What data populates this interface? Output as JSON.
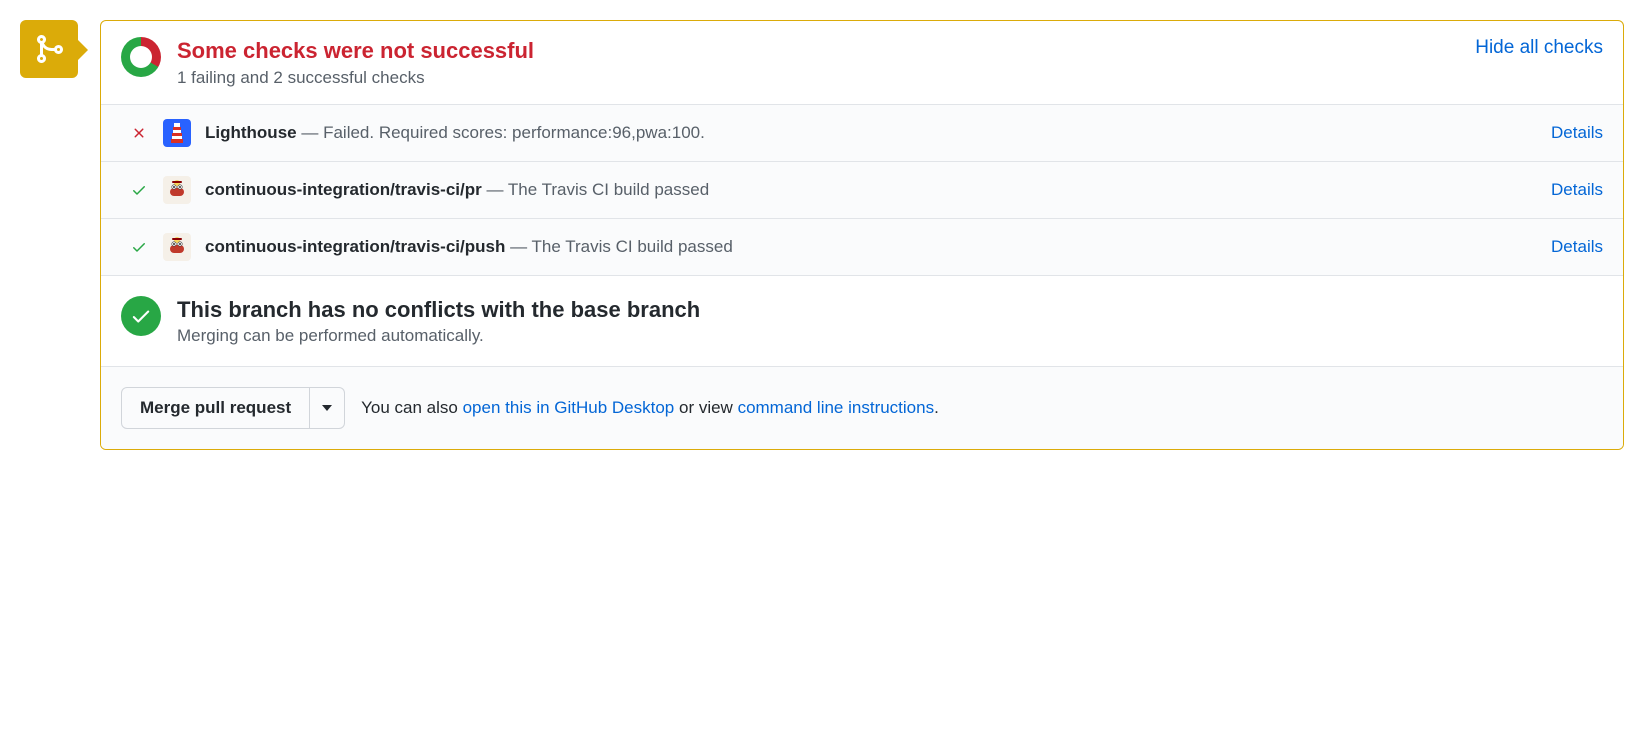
{
  "header": {
    "title": "Some checks were not successful",
    "subtitle": "1 failing and 2 successful checks",
    "toggle": "Hide all checks"
  },
  "checks": [
    {
      "status": "fail",
      "name": "Lighthouse",
      "desc": "Failed. Required scores: performance:96,pwa:100.",
      "details": "Details"
    },
    {
      "status": "pass",
      "name": "continuous-integration/travis-ci/pr",
      "desc": "The Travis CI build passed",
      "details": "Details"
    },
    {
      "status": "pass",
      "name": "continuous-integration/travis-ci/push",
      "desc": "The Travis CI build passed",
      "details": "Details"
    }
  ],
  "conflict": {
    "title": "This branch has no conflicts with the base branch",
    "subtitle": "Merging can be performed automatically."
  },
  "footer": {
    "merge_label": "Merge pull request",
    "prefix": "You can also ",
    "desktop_link": "open this in GitHub Desktop",
    "middle": " or view ",
    "cli_link": "command line instructions",
    "suffix": "."
  }
}
